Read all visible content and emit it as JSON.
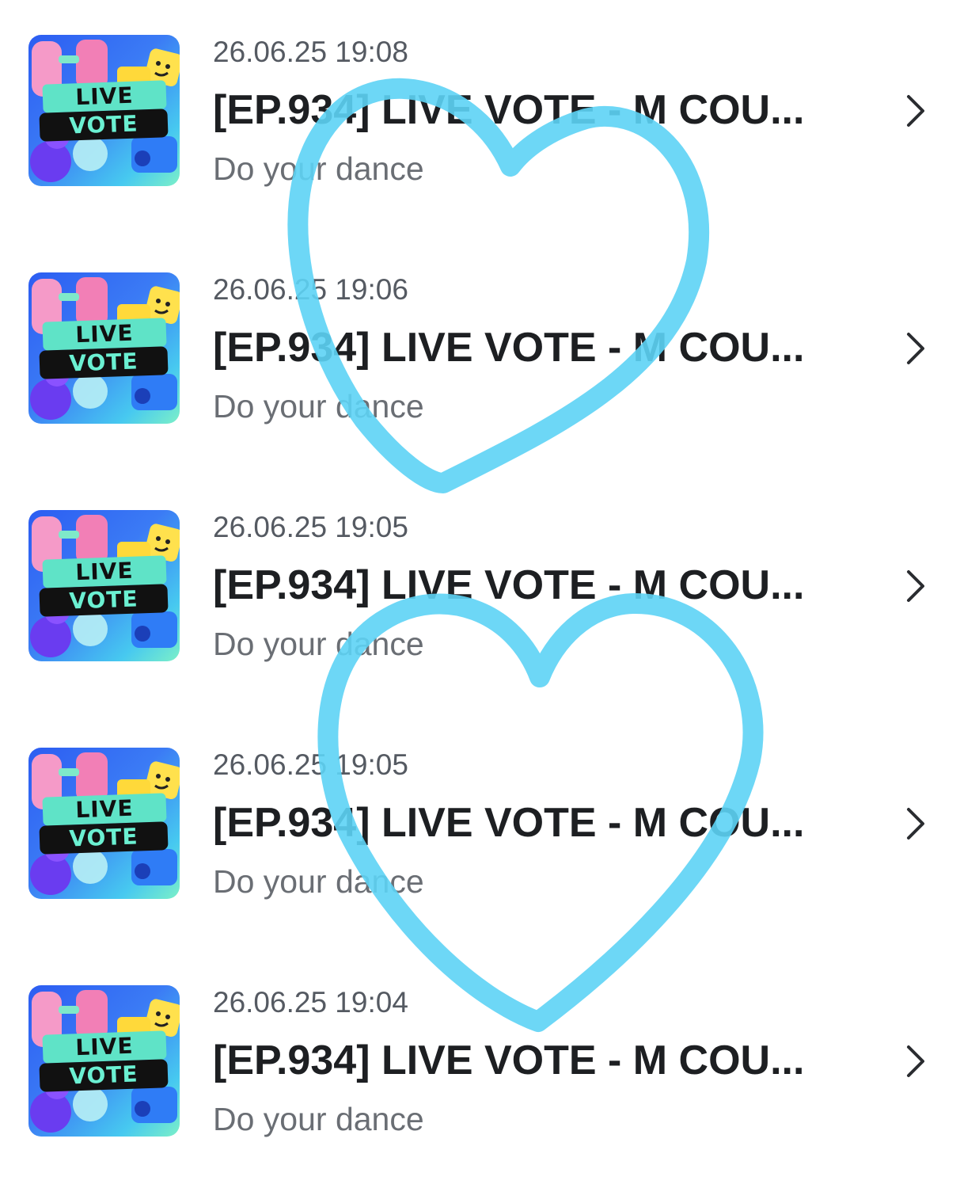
{
  "items": [
    {
      "time": "26.06.25 19:08",
      "title": "[EP.934] LIVE VOTE - M COU...",
      "description": "Do your dance",
      "thumb_line1": "LIVE",
      "thumb_line2": "VOTE"
    },
    {
      "time": "26.06.25 19:06",
      "title": "[EP.934] LIVE VOTE - M COU...",
      "description": "Do your dance",
      "thumb_line1": "LIVE",
      "thumb_line2": "VOTE"
    },
    {
      "time": "26.06.25 19:05",
      "title": "[EP.934] LIVE VOTE - M COU...",
      "description": "Do your dance",
      "thumb_line1": "LIVE",
      "thumb_line2": "VOTE"
    },
    {
      "time": "26.06.25 19:05",
      "title": "[EP.934] LIVE VOTE - M COU...",
      "description": "Do your dance",
      "thumb_line1": "LIVE",
      "thumb_line2": "VOTE"
    },
    {
      "time": "26.06.25 19:04",
      "title": "[EP.934] LIVE VOTE - M COU...",
      "description": "Do your dance",
      "thumb_line1": "LIVE",
      "thumb_line2": "VOTE"
    }
  ],
  "icons": {
    "chevron": "chevron-right-icon",
    "overlay": "heart-icon"
  },
  "colors": {
    "heart": "#5dd3f5",
    "title": "#1d1f22",
    "time": "#555a62",
    "description": "#6a6e74",
    "chevron": "#2a2c30"
  }
}
